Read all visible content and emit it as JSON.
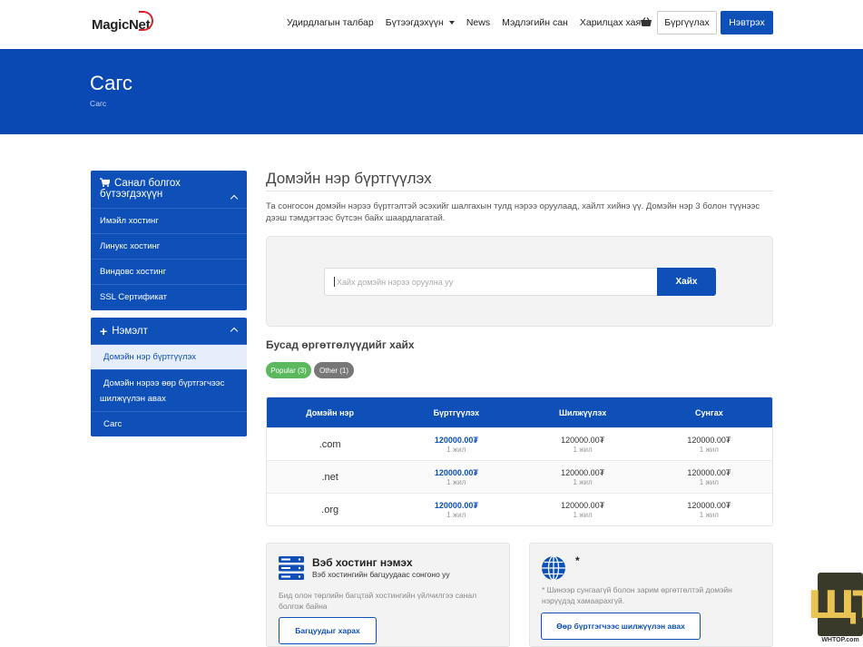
{
  "header": {
    "logo": "MagicNet",
    "nav": [
      "Удирдлагын талбар",
      "Бүтээгдэхүүн",
      "News",
      "Мэдлэгийн сан",
      "Харилцах хаяг"
    ],
    "cart_icon": "basket-icon",
    "register_label": "Бүргүүлах",
    "login_label": "Нэвтрэх"
  },
  "hero": {
    "title": "Сагс",
    "breadcrumb": "Сагс"
  },
  "sidebar": {
    "products": {
      "title": "Санал болгох бүтээгдэхүүн",
      "icon": "cart-icon",
      "items": [
        "Имэйл хостинг",
        "Линукс хостинг",
        "Виндовс хостинг",
        "SSL Сертификат"
      ]
    },
    "addons": {
      "title": "Нэмэлт",
      "icon": "plus-icon",
      "items": [
        "Домэйн нэр бүртгүүлэх",
        "Домэйн нэрээ өөр бүртгэгчээс шилжүүлэн авах",
        "Сагс"
      ]
    }
  },
  "main": {
    "title": "Домэйн нэр бүртгүүлэх",
    "intro": "Та сонгосон домэйн нэрээ бүртгэлтэй эсэхийг шалгахын тулд нэрээ оруулаад, хайлт хийнэ үү. Домэйн нэр 3 болон түүнээс дээш тэмдэгтээс бүтсэн байх шаардлагатай.",
    "search_placeholder": "Хайх домэйн нэрээ оруулна уу",
    "search_button": "Хайх",
    "other_ext_title": "Бусад өргөтгөлүүдийг хайх",
    "pill_popular": "Popular (3)",
    "pill_other": "Other (1)"
  },
  "pricing_table": {
    "headers": [
      "Домэйн нэр",
      "Бүртгүүлэх",
      "Шилжүүлэх",
      "Сунгах"
    ],
    "rows": [
      {
        "tld": ".com",
        "register": "120000.00₮",
        "transfer": "120000.00₮",
        "renew": "120000.00₮",
        "period": "1 жил"
      },
      {
        "tld": ".net",
        "register": "120000.00₮",
        "transfer": "120000.00₮",
        "renew": "120000.00₮",
        "period": "1 жил"
      },
      {
        "tld": ".org",
        "register": "120000.00₮",
        "transfer": "120000.00₮",
        "renew": "120000.00₮",
        "period": "1 жил"
      }
    ]
  },
  "promos": {
    "hosting": {
      "title": "Вэб хостинг нэмэх",
      "subtitle": "Вэб хостингийн багцуудаас сонгоно уу",
      "description": "Бид олон төрлийн багцтай хостингийн үйлчилгээ санал болгож байна",
      "button": "Багцуудыг харах",
      "icon": "server-icon"
    },
    "transfer": {
      "title": "*",
      "description": "* Шинээр сунгаагүй болон зарим өргөтгөлтэй домэйн нэрүүдэд хамаарахгүй.",
      "button": "Өөр бүртгэгчээс шилжүүлэн авах",
      "icon": "globe-icon"
    }
  },
  "watermark": {
    "letters": "ЩТ",
    "text": "WHTOP.com"
  },
  "colors": {
    "primary": "#0e4fb8",
    "hero": "#0a48b3",
    "popular": "#5cb85c",
    "other": "#777777"
  }
}
